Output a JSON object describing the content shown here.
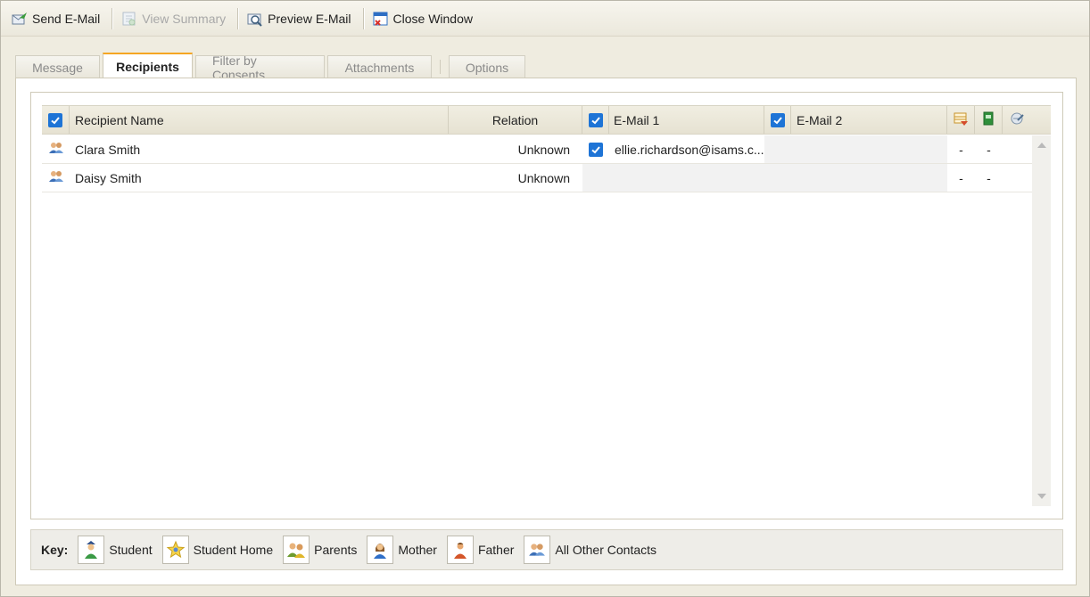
{
  "toolbar": {
    "send_label": "Send E-Mail",
    "summary_label": "View Summary",
    "preview_label": "Preview E-Mail",
    "close_label": "Close Window"
  },
  "tabs": {
    "message": "Message",
    "recipients": "Recipients",
    "filter": "Filter by Consents",
    "attachments": "Attachments",
    "options": "Options",
    "active": "Recipients"
  },
  "grid": {
    "headers": {
      "name": "Recipient Name",
      "relation": "Relation",
      "email1": "E-Mail 1",
      "email2": "E-Mail 2"
    },
    "select_all_checked": true,
    "email1_all_checked": true,
    "email2_all_checked": true,
    "rows": [
      {
        "icon": "all-other-contacts-icon",
        "name": "Clara Smith",
        "relation": "Unknown",
        "email1_checked": true,
        "email1": "ellie.richardson@isams.c...",
        "email2": "",
        "col_a": "-",
        "col_b": "-"
      },
      {
        "icon": "all-other-contacts-icon",
        "name": "Daisy Smith",
        "relation": "Unknown",
        "email1_checked": false,
        "email1": "",
        "email2": "",
        "col_a": "-",
        "col_b": "-"
      }
    ]
  },
  "key": {
    "label": "Key:",
    "items": [
      {
        "icon": "student-icon",
        "label": "Student"
      },
      {
        "icon": "student-home-icon",
        "label": "Student Home"
      },
      {
        "icon": "parents-icon",
        "label": "Parents"
      },
      {
        "icon": "mother-icon",
        "label": "Mother"
      },
      {
        "icon": "father-icon",
        "label": "Father"
      },
      {
        "icon": "all-other-contacts-icon",
        "label": "All Other Contacts"
      }
    ]
  },
  "colors": {
    "accent_tab": "#f5a623",
    "checkbox": "#1e74d6"
  }
}
